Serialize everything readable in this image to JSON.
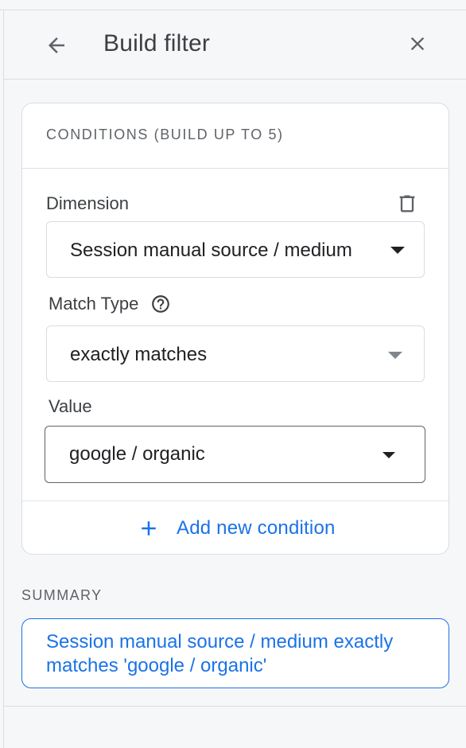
{
  "header": {
    "title": "Build filter",
    "back_icon": "arrow-back-icon",
    "close_icon": "close-icon"
  },
  "conditions": {
    "heading": "CONDITIONS (BUILD UP TO 5)",
    "dimension": {
      "label": "Dimension",
      "value": "Session manual source / medium",
      "delete_icon": "trash-icon"
    },
    "match_type": {
      "label": "Match Type",
      "help_icon": "help-circle-icon",
      "value": "exactly matches"
    },
    "value_field": {
      "label": "Value",
      "value": "google / organic"
    },
    "add_condition_label": "Add new condition",
    "add_icon": "plus-icon"
  },
  "summary": {
    "heading": "SUMMARY",
    "text": "Session manual source / medium exactly matches 'google / organic'"
  },
  "colors": {
    "accent": "#1a73e8",
    "text": "#202124",
    "muted": "#5f6368",
    "border": "#dadce0",
    "background": "#f6f7f9"
  }
}
